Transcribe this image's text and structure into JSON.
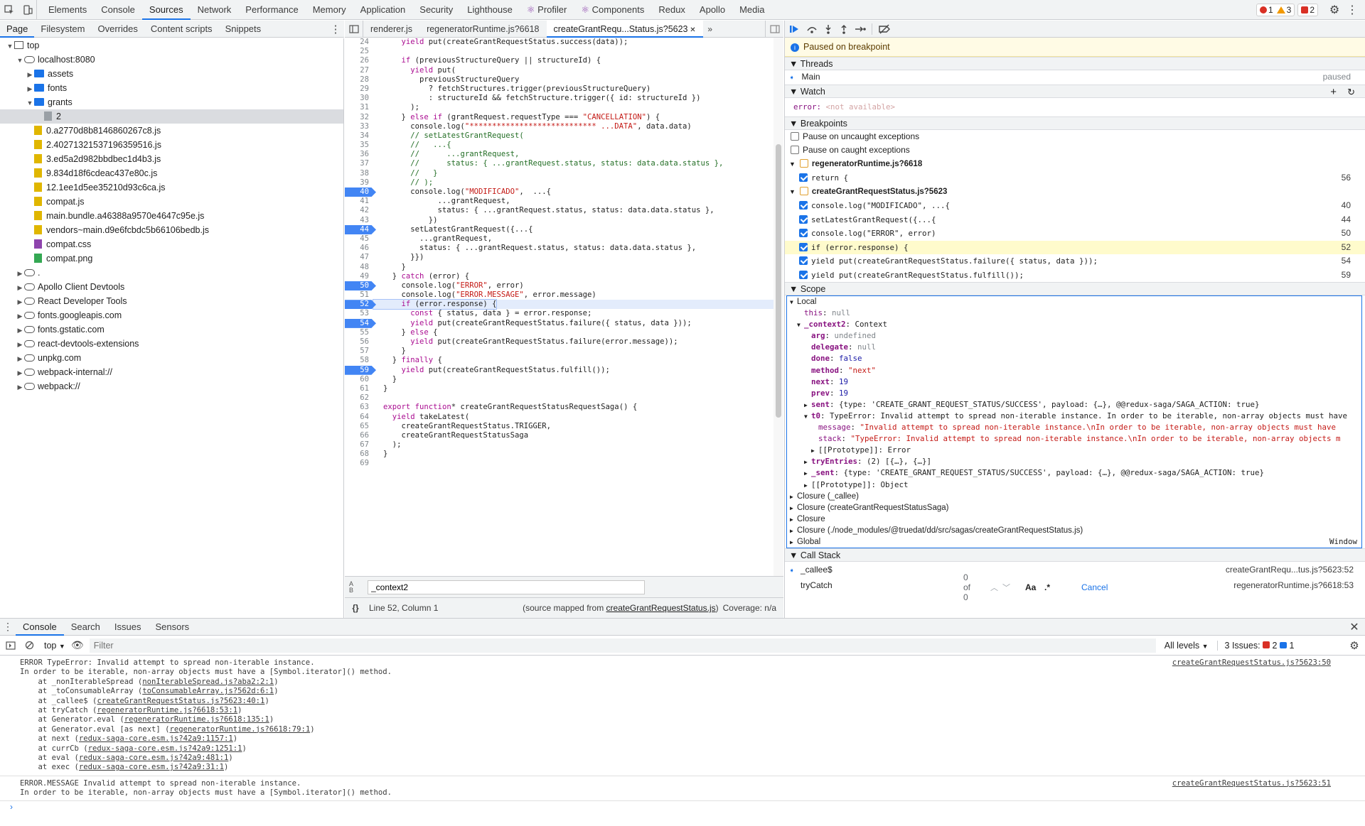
{
  "top_tabs": [
    "Elements",
    "Console",
    "Sources",
    "Network",
    "Performance",
    "Memory",
    "Application",
    "Security",
    "Lighthouse",
    "Profiler",
    "Components",
    "Redux",
    "Apollo",
    "Media"
  ],
  "top_badges": {
    "errors": "1",
    "warnings": "3",
    "issues": "2"
  },
  "nav_tabs": [
    "Page",
    "Filesystem",
    "Overrides",
    "Content scripts",
    "Snippets"
  ],
  "tree": [
    {
      "label": "top",
      "type": "frame",
      "depth": 0,
      "arrow": "▼"
    },
    {
      "label": "localhost:8080",
      "type": "cloud",
      "depth": 1,
      "arrow": "▼"
    },
    {
      "label": "assets",
      "type": "folder",
      "depth": 2,
      "arrow": "▶"
    },
    {
      "label": "fonts",
      "type": "folder",
      "depth": 2,
      "arrow": "▶"
    },
    {
      "label": "grants",
      "type": "folder",
      "depth": 2,
      "arrow": "▼"
    },
    {
      "label": "2",
      "type": "gray",
      "depth": 3,
      "arrow": "",
      "selected": true
    },
    {
      "label": "0.a2770d8b8146860267c8.js",
      "type": "js",
      "depth": 2,
      "arrow": ""
    },
    {
      "label": "2.40271321537196359516.js",
      "type": "js",
      "depth": 2,
      "arrow": ""
    },
    {
      "label": "3.ed5a2d982bbdbec1d4b3.js",
      "type": "js",
      "depth": 2,
      "arrow": ""
    },
    {
      "label": "9.834d18f6cdeac437e80c.js",
      "type": "js",
      "depth": 2,
      "arrow": ""
    },
    {
      "label": "12.1ee1d5ee35210d93c6ca.js",
      "type": "js",
      "depth": 2,
      "arrow": ""
    },
    {
      "label": "compat.js",
      "type": "js",
      "depth": 2,
      "arrow": ""
    },
    {
      "label": "main.bundle.a46388a9570e4647c95e.js",
      "type": "js",
      "depth": 2,
      "arrow": ""
    },
    {
      "label": "vendors~main.d9e6fcbdc5b66106bedb.js",
      "type": "js",
      "depth": 2,
      "arrow": ""
    },
    {
      "label": "compat.css",
      "type": "css",
      "depth": 2,
      "arrow": ""
    },
    {
      "label": "compat.png",
      "type": "png",
      "depth": 2,
      "arrow": ""
    },
    {
      "label": ".",
      "type": "cloud",
      "depth": 1,
      "arrow": "▶"
    },
    {
      "label": "Apollo Client Devtools",
      "type": "cloud",
      "depth": 1,
      "arrow": "▶"
    },
    {
      "label": "React Developer Tools",
      "type": "cloud",
      "depth": 1,
      "arrow": "▶"
    },
    {
      "label": "fonts.googleapis.com",
      "type": "cloud",
      "depth": 1,
      "arrow": "▶"
    },
    {
      "label": "fonts.gstatic.com",
      "type": "cloud",
      "depth": 1,
      "arrow": "▶"
    },
    {
      "label": "react-devtools-extensions",
      "type": "cloud",
      "depth": 1,
      "arrow": "▶"
    },
    {
      "label": "unpkg.com",
      "type": "cloud",
      "depth": 1,
      "arrow": "▶"
    },
    {
      "label": "webpack-internal://",
      "type": "cloud",
      "depth": 1,
      "arrow": "▶"
    },
    {
      "label": "webpack://",
      "type": "cloud",
      "depth": 1,
      "arrow": "▶"
    }
  ],
  "editor_tabs": [
    {
      "label": "renderer.js",
      "active": false
    },
    {
      "label": "regeneratorRuntime.js?6618",
      "active": false
    },
    {
      "label": "createGrantRequ...Status.js?5623",
      "active": true
    }
  ],
  "code": [
    {
      "n": "24",
      "t": "    yield put(createGrantRequestStatus.success(data));"
    },
    {
      "n": "25",
      "t": ""
    },
    {
      "n": "26",
      "t": "    if (previousStructureQuery || structureId) {"
    },
    {
      "n": "27",
      "t": "      yield put("
    },
    {
      "n": "28",
      "t": "        previousStructureQuery"
    },
    {
      "n": "29",
      "t": "          ? fetchStructures.trigger(previousStructureQuery)"
    },
    {
      "n": "30",
      "t": "          : structureId && fetchStructure.trigger({ id: structureId })"
    },
    {
      "n": "31",
      "t": "      );"
    },
    {
      "n": "32",
      "t": "    } else if (grantRequest.requestType === \"CANCELLATION\") {"
    },
    {
      "n": "33",
      "t": "      console.log(\"**************************** ...DATA\", data.data)"
    },
    {
      "n": "34",
      "t": "      // setLatestGrantRequest("
    },
    {
      "n": "35",
      "t": "      //   ...{"
    },
    {
      "n": "36",
      "t": "      //      ...grantRequest,"
    },
    {
      "n": "37",
      "t": "      //      status: { ...grantRequest.status, status: data.data.status },"
    },
    {
      "n": "38",
      "t": "      //   }"
    },
    {
      "n": "39",
      "t": "      // );"
    },
    {
      "n": "40",
      "t": "      console.log(\"MODIFICADO\",  ...{",
      "bp": true
    },
    {
      "n": "41",
      "t": "            ...grantRequest,"
    },
    {
      "n": "42",
      "t": "            status: { ...grantRequest.status, status: data.data.status },"
    },
    {
      "n": "43",
      "t": "          })"
    },
    {
      "n": "44",
      "t": "      setLatestGrantRequest({...{",
      "bp": true
    },
    {
      "n": "45",
      "t": "        ...grantRequest,"
    },
    {
      "n": "46",
      "t": "        status: { ...grantRequest.status, status: data.data.status },"
    },
    {
      "n": "47",
      "t": "      }})"
    },
    {
      "n": "48",
      "t": "    }"
    },
    {
      "n": "49",
      "t": "  } catch (error) {"
    },
    {
      "n": "50",
      "t": "    console.log(\"ERROR\", error)",
      "bp": true
    },
    {
      "n": "51",
      "t": "    console.log(\"ERROR.MESSAGE\", error.message)"
    },
    {
      "n": "52",
      "t": "    if (error.response) {",
      "bp": true,
      "cur": true
    },
    {
      "n": "53",
      "t": "      const { status, data } = error.response;"
    },
    {
      "n": "54",
      "t": "      yield put(createGrantRequestStatus.failure({ status, data }));",
      "bp": true
    },
    {
      "n": "55",
      "t": "    } else {"
    },
    {
      "n": "56",
      "t": "      yield put(createGrantRequestStatus.failure(error.message));"
    },
    {
      "n": "57",
      "t": "    }"
    },
    {
      "n": "58",
      "t": "  } finally {"
    },
    {
      "n": "59",
      "t": "    yield put(createGrantRequestStatus.fulfill());",
      "bp": true
    },
    {
      "n": "60",
      "t": "  }"
    },
    {
      "n": "61",
      "t": "}"
    },
    {
      "n": "62",
      "t": ""
    },
    {
      "n": "63",
      "t": "export function* createGrantRequestStatusRequestSaga() {"
    },
    {
      "n": "64",
      "t": "  yield takeLatest("
    },
    {
      "n": "65",
      "t": "    createGrantRequestStatus.TRIGGER,"
    },
    {
      "n": "66",
      "t": "    createGrantRequestStatusSaga"
    },
    {
      "n": "67",
      "t": "  );"
    },
    {
      "n": "68",
      "t": "}"
    },
    {
      "n": "69",
      "t": ""
    }
  ],
  "search": {
    "value": "_context2",
    "count": "0 of 0",
    "case_label": "Aa",
    "regex_label": ".*",
    "cancel": "Cancel"
  },
  "status": {
    "position": "Line 52, Column 1",
    "mapped_prefix": "(source mapped from ",
    "mapped_file": "createGrantRequestStatus.js",
    "mapped_suffix": ")",
    "coverage": "Coverage: n/a"
  },
  "debugger": {
    "paused": "Paused on breakpoint",
    "threads_title": "Threads",
    "thread_name": "Main",
    "thread_state": "paused",
    "watch_title": "Watch",
    "watch_key": "error:",
    "watch_val": "<not available>",
    "bp_title": "Breakpoints",
    "pause_uncaught": "Pause on uncaught exceptions",
    "pause_caught": "Pause on caught exceptions",
    "bp_groups": [
      {
        "file": "regeneratorRuntime.js?6618",
        "items": [
          {
            "code": "return {",
            "line": "56"
          }
        ]
      },
      {
        "file": "createGrantRequestStatus.js?5623",
        "items": [
          {
            "code": "console.log(\"MODIFICADO\", ...{",
            "line": "40"
          },
          {
            "code": "setLatestGrantRequest({...{",
            "line": "44"
          },
          {
            "code": "console.log(\"ERROR\", error)",
            "line": "50"
          },
          {
            "code": "if (error.response) {",
            "line": "52",
            "hl": true
          },
          {
            "code": "yield put(createGrantRequestStatus.failure({ status, data }));",
            "line": "54"
          },
          {
            "code": "yield put(createGrantRequestStatus.fulfill());",
            "line": "59"
          }
        ]
      }
    ],
    "scope_title": "Scope",
    "scope": [
      {
        "d": 0,
        "a": "▼",
        "html": "Local"
      },
      {
        "d": 1,
        "a": "",
        "k": "this",
        "v": "null",
        "vc": "pnull"
      },
      {
        "d": 1,
        "a": "▼",
        "k": "_context2",
        "v": "Context",
        "vc": ""
      },
      {
        "d": 2,
        "a": "",
        "k": "arg",
        "v": "undefined",
        "vc": "pnull"
      },
      {
        "d": 2,
        "a": "",
        "k": "delegate",
        "v": "null",
        "vc": "pnull"
      },
      {
        "d": 2,
        "a": "",
        "k": "done",
        "v": "false",
        "vc": "pn"
      },
      {
        "d": 2,
        "a": "",
        "k": "method",
        "v": "\"next\"",
        "vc": "ps"
      },
      {
        "d": 2,
        "a": "",
        "k": "next",
        "v": "19",
        "vc": "pn"
      },
      {
        "d": 2,
        "a": "",
        "k": "prev",
        "v": "19",
        "vc": "pn"
      },
      {
        "d": 2,
        "a": "▶",
        "k": "sent",
        "v": "{type: 'CREATE_GRANT_REQUEST_STATUS/SUCCESS', payload: {…}, @@redux-saga/SAGA_ACTION: true}",
        "vc": ""
      },
      {
        "d": 2,
        "a": "▼",
        "k": "t0",
        "v": "TypeError: Invalid attempt to spread non-iterable instance. In order to be iterable, non-array objects must have",
        "vc": ""
      },
      {
        "d": 3,
        "a": "",
        "k": "message",
        "v": "\"Invalid attempt to spread non-iterable instance.\\nIn order to be iterable, non-array objects must have",
        "vc": "ps"
      },
      {
        "d": 3,
        "a": "",
        "k": "stack",
        "v": "\"TypeError: Invalid attempt to spread non-iterable instance.\\nIn order to be iterable, non-array objects m",
        "vc": "ps"
      },
      {
        "d": 3,
        "a": "▶",
        "k": "[[Prototype]]",
        "v": "Error",
        "vc": "",
        "plain": true
      },
      {
        "d": 2,
        "a": "▶",
        "k": "tryEntries",
        "v": "(2) [{…}, {…}]",
        "vc": ""
      },
      {
        "d": 2,
        "a": "▶",
        "k": "_sent",
        "v": "{type: 'CREATE_GRANT_REQUEST_STATUS/SUCCESS', payload: {…}, @@redux-saga/SAGA_ACTION: true}",
        "vc": ""
      },
      {
        "d": 2,
        "a": "▶",
        "k": "[[Prototype]]",
        "v": "Object",
        "vc": "",
        "plain": true
      },
      {
        "d": 0,
        "a": "▶",
        "html": "Closure (_callee)"
      },
      {
        "d": 0,
        "a": "▶",
        "html": "Closure (createGrantRequestStatusSaga)"
      },
      {
        "d": 0,
        "a": "▶",
        "html": "Closure"
      },
      {
        "d": 0,
        "a": "▶",
        "html": "Closure (./node_modules/@truedat/dd/src/sagas/createGrantRequestStatus.js)"
      },
      {
        "d": 0,
        "a": "▶",
        "html": "Global",
        "right": "Window"
      }
    ],
    "callstack_title": "Call Stack",
    "callstack": [
      {
        "fn": "_callee$",
        "loc": "createGrantRequ...tus.js?5623:52",
        "active": true
      },
      {
        "fn": "tryCatch",
        "loc": "regeneratorRuntime.js?6618:53"
      }
    ]
  },
  "drawer_tabs": [
    "Console",
    "Search",
    "Issues",
    "Sensors"
  ],
  "console_toolbar": {
    "context": "top",
    "filter_placeholder": "Filter",
    "levels": "All levels",
    "issues_label": "3 Issues:",
    "issues_err": "2",
    "issues_info": "1"
  },
  "console_msgs": [
    {
      "src": "createGrantRequestStatus.js?5623:50",
      "lines": [
        [
          "ERROR TypeError: Invalid attempt to spread non-iterable instance."
        ],
        [
          "In order to be iterable, non-array objects must have a [Symbol.iterator]() method."
        ],
        [
          "    at _nonIterableSpread (",
          "nonIterableSpread.js?aba2:2:1",
          ")"
        ],
        [
          "    at _toConsumableArray (",
          "toConsumableArray.js?562d:6:1",
          ")"
        ],
        [
          "    at _callee$ (",
          "createGrantRequestStatus.js?5623:40:1",
          ")"
        ],
        [
          "    at tryCatch (",
          "regeneratorRuntime.js?6618:53:1",
          ")"
        ],
        [
          "    at Generator.eval (",
          "regeneratorRuntime.js?6618:135:1",
          ")"
        ],
        [
          "    at Generator.eval [as next] (",
          "regeneratorRuntime.js?6618:79:1",
          ")"
        ],
        [
          "    at next (",
          "redux-saga-core.esm.js?42a9:1157:1",
          ")"
        ],
        [
          "    at currCb (",
          "redux-saga-core.esm.js?42a9:1251:1",
          ")"
        ],
        [
          "    at eval (",
          "redux-saga-core.esm.js?42a9:481:1",
          ")"
        ],
        [
          "    at exec (",
          "redux-saga-core.esm.js?42a9:31:1",
          ")"
        ]
      ]
    },
    {
      "src": "createGrantRequestStatus.js?5623:51",
      "lines": [
        [
          "ERROR.MESSAGE Invalid attempt to spread non-iterable instance."
        ],
        [
          "In order to be iterable, non-array objects must have a [Symbol.iterator]() method."
        ]
      ]
    }
  ]
}
